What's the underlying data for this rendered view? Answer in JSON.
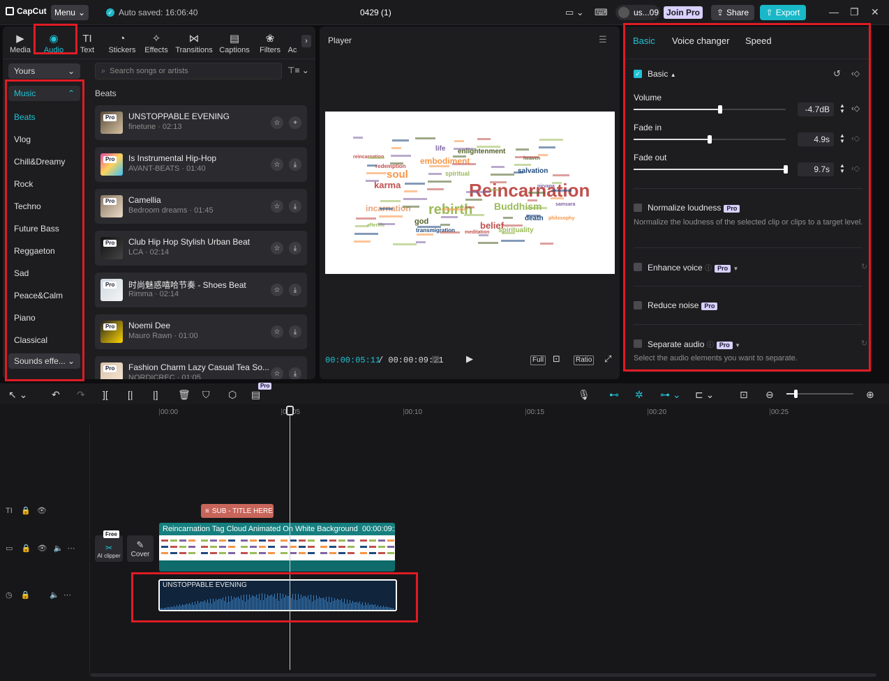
{
  "topbar": {
    "logo": "CapCut",
    "menu_label": "Menu",
    "autosave": "Auto saved: 16:06:40",
    "project_title": "0429 (1)",
    "user": "us...09",
    "join_pro": "Join Pro",
    "share": "Share",
    "export": "Export"
  },
  "toolbar": {
    "items": [
      {
        "label": "Media",
        "icon": "media-icon"
      },
      {
        "label": "Audio",
        "icon": "audio-icon"
      },
      {
        "label": "Text",
        "icon": "text-icon"
      },
      {
        "label": "Stickers",
        "icon": "stickers-icon"
      },
      {
        "label": "Effects",
        "icon": "effects-icon"
      },
      {
        "label": "Transitions",
        "icon": "transitions-icon"
      },
      {
        "label": "Captions",
        "icon": "captions-icon"
      },
      {
        "label": "Filters",
        "icon": "filters-icon"
      },
      {
        "label": "Ac",
        "icon": "adjust-icon"
      }
    ],
    "active": "Audio"
  },
  "library": {
    "source_dropdown": "Yours",
    "music_header": "Music",
    "categories": [
      "Beats",
      "Vlog",
      "Chill&Dreamy",
      "Rock",
      "Techno",
      "Future Bass",
      "Reggaeton",
      "Sad",
      "Peace&Calm",
      "Piano",
      "Classical"
    ],
    "active_category": "Beats",
    "sounds_effects": "Sounds effe...",
    "search_placeholder": "Search songs or artists",
    "section_title": "Beats",
    "songs": [
      {
        "title": "UNSTOPPABLE EVENING",
        "meta": "finetune · 02:13",
        "action": "add"
      },
      {
        "title": "Is Instrumental Hip-Hop",
        "meta": "AVANT-BEATS · 01:40",
        "action": "download"
      },
      {
        "title": "Camellia",
        "meta": "Bedroom dreams · 01:45",
        "action": "download"
      },
      {
        "title": "Club Hip Hop Stylish Urban Beat",
        "meta": "LCA · 02:14",
        "action": "download"
      },
      {
        "title": "时尚魅惑嘻哈节奏 - Shoes Beat",
        "meta": "Rimma · 02:14",
        "action": "download"
      },
      {
        "title": "Noemi Dee",
        "meta": "Mauro Rawn · 01:00",
        "action": "download"
      },
      {
        "title": "Fashion Charm Lazy Casual Tea So...",
        "meta": "NORDICREC · 01:05",
        "action": "download"
      }
    ],
    "pro_badge": "Pro"
  },
  "player": {
    "title": "Player",
    "current_time": "00:00:05:11",
    "total_time": "/ 00:00:09:21",
    "full": "Full",
    "ratio": "Ratio",
    "wordcloud": [
      "Reincarnation",
      "rebirth",
      "Buddhism",
      "soul",
      "karma",
      "embodiment",
      "incarnation",
      "belief",
      "enlightenment",
      "spirituality",
      "death",
      "god",
      "salvation",
      "spiritual",
      "life",
      "redemption",
      "transmigration",
      "reincarnation",
      "nirvana",
      "meditation",
      "samsara",
      "heaven",
      "afterlife",
      "philosophy"
    ]
  },
  "inspector": {
    "tabs": [
      "Basic",
      "Voice changer",
      "Speed"
    ],
    "active_tab": "Basic",
    "basic_section": "Basic",
    "volume_label": "Volume",
    "volume_value": "-4.7dB",
    "volume_level": 0.57,
    "fadein_label": "Fade in",
    "fadein_value": "4.9s",
    "fadein_level": 0.5,
    "fadeout_label": "Fade out",
    "fadeout_value": "9.7s",
    "fadeout_level": 1.0,
    "normalize_label": "Normalize loudness",
    "normalize_desc": "Normalize the loudness of the selected clip or clips to a target level.",
    "enhance_label": "Enhance voice",
    "reduce_label": "Reduce noise",
    "separate_label": "Separate audio",
    "separate_desc": "Select the audio elements you want to separate.",
    "pro_badge": "Pro"
  },
  "timeline": {
    "ruler": [
      "00:00",
      "00:05",
      "00:10",
      "00:15",
      "00:20",
      "00:25"
    ],
    "subtitle_clip": "SUB - TITLE HERE",
    "video_clip_title": "Reincarnation Tag Cloud Animated On White Background",
    "video_clip_duration": "00:00:09:21",
    "audio_clip_title": "UNSTOPPABLE EVENING",
    "ai_clipper": "AI clipper",
    "free_badge": "Free",
    "cover": "Cover",
    "pro_badge": "Pro"
  },
  "colors": {
    "accent": "#1fc4d4",
    "highlight": "#e01b24"
  }
}
